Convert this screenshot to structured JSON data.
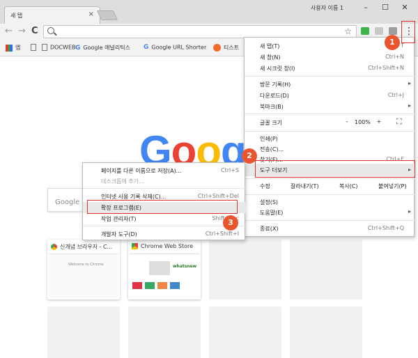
{
  "tab": {
    "title": "새 탭",
    "close": "×"
  },
  "window": {
    "profile": "사용자 이름 1",
    "minimize": "–",
    "maximize": "☐",
    "close": "✕"
  },
  "toolbar": {
    "back": "←",
    "forward": "→",
    "reload": "C",
    "star": "☆",
    "menu": "⋮"
  },
  "bookmarks": [
    {
      "label": "앱",
      "icon": "apps-grid-icon"
    },
    {
      "label": "",
      "icon": "page-icon"
    },
    {
      "label": "DOCWEB",
      "icon": "page-icon"
    },
    {
      "label": "Google 애널리틱스",
      "icon": "google-g-icon"
    },
    {
      "label": "Google URL Shorter",
      "icon": "google-g-icon"
    },
    {
      "label": "티스트",
      "icon": "tistory-icon"
    }
  ],
  "content": {
    "logo": [
      "G",
      "o",
      "o",
      "g"
    ],
    "logo_colors": [
      "#4285f4",
      "#ea4335",
      "#fbbc05",
      "#4285f4"
    ],
    "search_placeholder": "Google 검",
    "tiles": [
      {
        "title": "신개념 브라우저 - C...",
        "sub": "Welcome to Chrome"
      },
      {
        "title": "Chrome Web Store",
        "sub": "whatsnew"
      }
    ]
  },
  "main_menu": {
    "items": [
      {
        "label": "새 탭(T)",
        "shortcut": "Ctrl+T"
      },
      {
        "label": "새 창(N)",
        "shortcut": "Ctrl+N"
      },
      {
        "label": "새 시크릿 창(I)",
        "shortcut": "Ctrl+Shift+N"
      },
      {
        "label": "방문 기록(H)",
        "shortcut": ""
      },
      {
        "label": "다운로드(D)",
        "shortcut": "Ctrl+J"
      },
      {
        "label": "북마크(B)",
        "shortcut": ""
      },
      {
        "label": "글꼴 크기",
        "zoom_minus": "-",
        "zoom_value": "100%",
        "zoom_plus": "+",
        "fullscreen": "⛶"
      },
      {
        "label": "인쇄(P)",
        "shortcut": ""
      },
      {
        "label": "전송(C)...",
        "shortcut": ""
      },
      {
        "label": "찾기(F)...",
        "shortcut": "Ctrl+F"
      },
      {
        "label": "도구 더보기",
        "shortcut": ""
      },
      {
        "label": "수정",
        "cut": "잘라내기(T)",
        "copy": "복사(C)",
        "paste": "붙여넣기(P)"
      },
      {
        "label": "설정(S)",
        "shortcut": ""
      },
      {
        "label": "도움말(E)",
        "shortcut": ""
      },
      {
        "label": "종료(X)",
        "shortcut": "Ctrl+Shift+Q"
      }
    ]
  },
  "sub_menu": {
    "items": [
      {
        "label": "페이지를 다른 이름으로 저장(A)...",
        "shortcut": "Ctrl+S"
      },
      {
        "label": "데스크톱에 추가...",
        "shortcut": ""
      },
      {
        "label": "인터넷 사용 기록 삭제(C)...",
        "shortcut": "Ctrl+Shift+Del"
      },
      {
        "label": "확장 프로그램(E)",
        "shortcut": ""
      },
      {
        "label": "작업 관리자(T)",
        "shortcut": "Shift+Esc"
      },
      {
        "label": "개발자 도구(D)",
        "shortcut": "Ctrl+Shift+I"
      }
    ]
  },
  "badges": [
    "1",
    "2",
    "3"
  ],
  "colors": {
    "annotation": "#e0302d",
    "badge": "#e8552f"
  }
}
